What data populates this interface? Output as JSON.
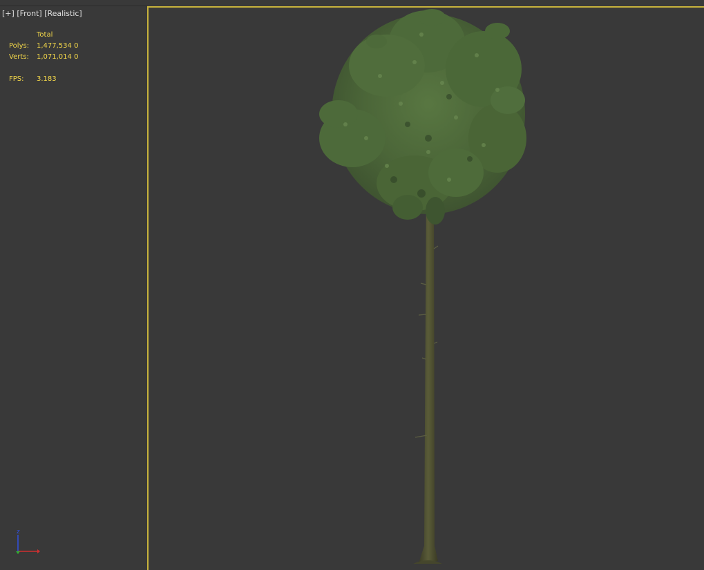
{
  "viewport": {
    "label_plus": "[+]",
    "label_view": "[Front]",
    "label_shading": "[Realistic]"
  },
  "stats": {
    "header": "Total",
    "polys_label": "Polys:",
    "polys_value": "1,477,534 0",
    "verts_label": "Verts:",
    "verts_value": "1,071,014 0",
    "fps_label": "FPS:",
    "fps_value": "3.183"
  },
  "axis_gizmo": {
    "z_label": "z",
    "x_color": "#d03030",
    "y_color": "#30b030",
    "z_color": "#3050e0"
  },
  "colors": {
    "background": "#393939",
    "active_border": "#c8b33c",
    "stats_text": "#f4d84a",
    "foliage": "#4f6a3a",
    "trunk": "#4a4a30"
  },
  "scene": {
    "object": "tree-model"
  }
}
